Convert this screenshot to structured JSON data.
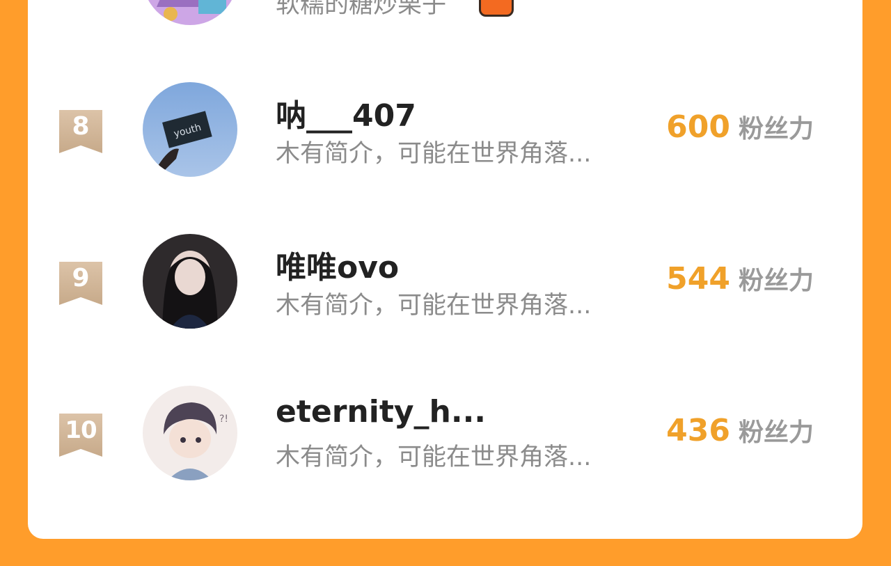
{
  "colors": {
    "background": "#ff9d2b",
    "card": "#ffffff",
    "rank_badge": "#d7b99c",
    "fan_number": "#f0a12a",
    "text_primary": "#222222",
    "text_secondary": "#8b8b8b"
  },
  "top_partial": {
    "bio": "软糯的糖炒栗子"
  },
  "entries": [
    {
      "rank": "8",
      "name": "呐___407",
      "bio": "木有简介，可能在世界角落...",
      "fans": "600",
      "fans_unit": "粉丝力",
      "avatar_icon": "youth-card-avatar-icon"
    },
    {
      "rank": "9",
      "name": "唯唯ovo",
      "bio": "木有简介，可能在世界角落...",
      "fans": "544",
      "fans_unit": "粉丝力",
      "avatar_icon": "girl-photo-avatar-icon"
    },
    {
      "rank": "10",
      "name": "eternity_h...",
      "bio": "木有简介，可能在世界角落...",
      "fans": "436",
      "fans_unit": "粉丝力",
      "avatar_icon": "anime-boy-avatar-icon"
    }
  ]
}
